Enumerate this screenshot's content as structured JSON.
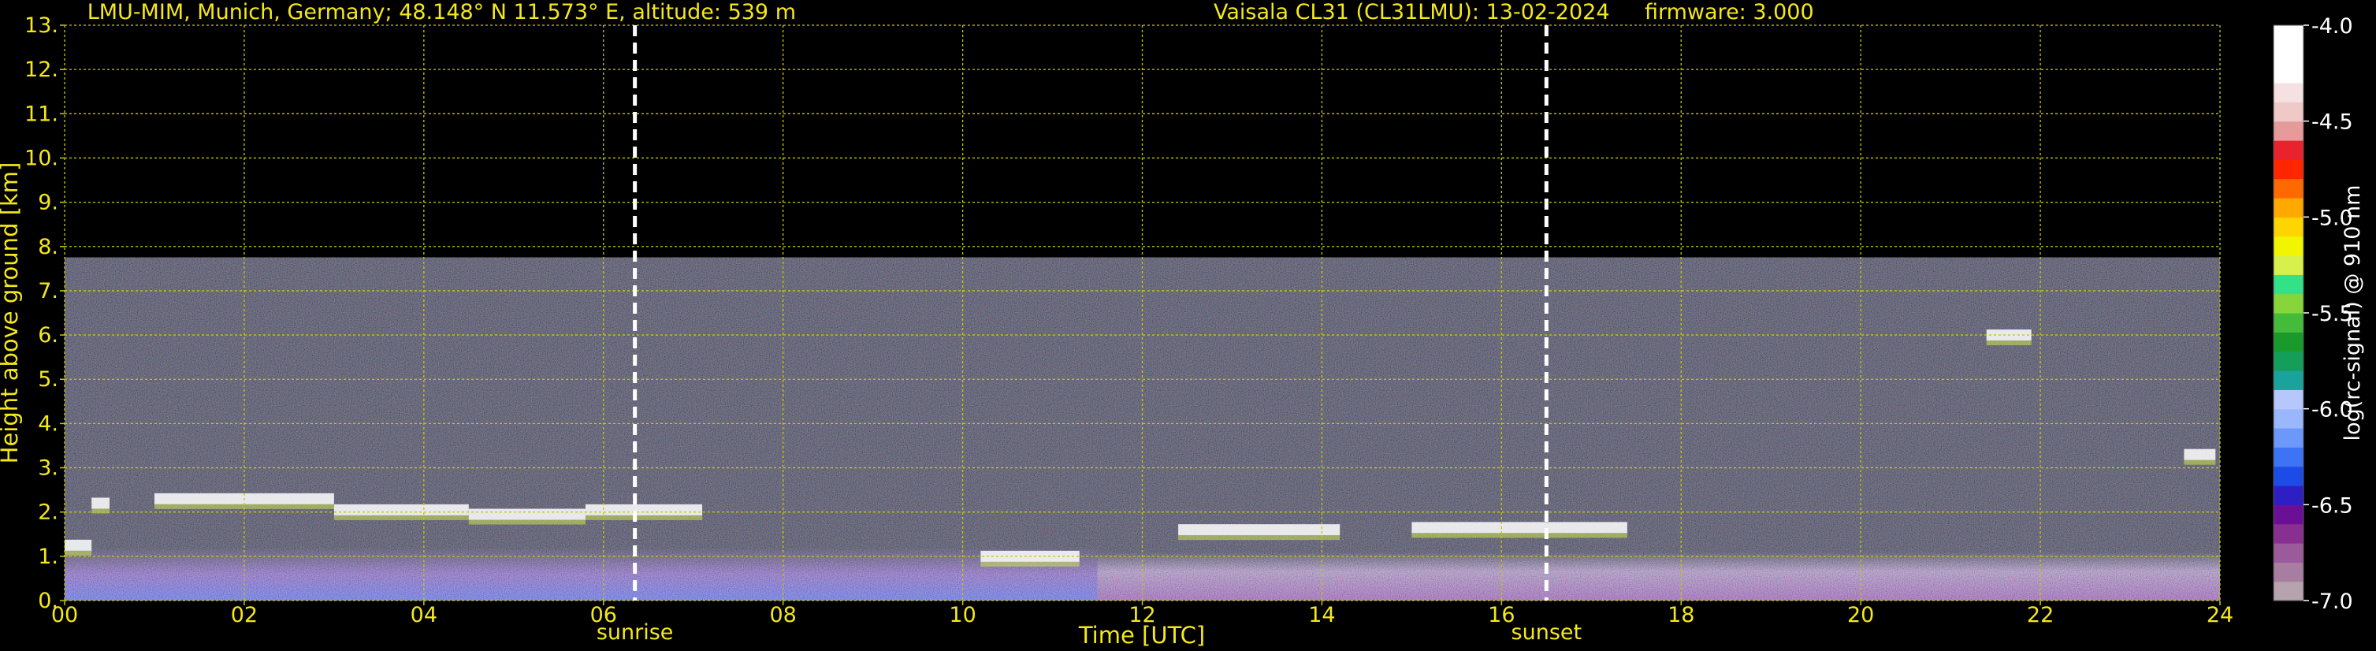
{
  "chart_data": {
    "type": "heatmap",
    "title_parts": [
      "LMU-MIM, Munich, Germany; 48.148° N 11.573° E, altitude: 539 m",
      "Vaisala CL31 (CL31LMU): 13-02-2024",
      "firmware: 3.000"
    ],
    "xlabel": "Time [UTC]",
    "ylabel": "Height above ground [km]",
    "xlim": [
      0,
      24
    ],
    "ylim": [
      0,
      13
    ],
    "x_ticks": [
      0,
      2,
      4,
      6,
      8,
      10,
      12,
      14,
      16,
      18,
      20,
      22,
      24
    ],
    "x_tick_labels": [
      "00",
      "02",
      "04",
      "06",
      "08",
      "10",
      "12",
      "14",
      "16",
      "18",
      "20",
      "22",
      "24"
    ],
    "y_ticks": [
      0,
      1,
      2,
      3,
      4,
      5,
      6,
      7,
      8,
      9,
      10,
      11,
      12,
      13
    ],
    "y_tick_labels": [
      "0.",
      "1.",
      "2.",
      "3.",
      "4.",
      "5.",
      "6.",
      "7.",
      "8.",
      "9.",
      "10.",
      "11.",
      "12.",
      "13."
    ],
    "grid": true,
    "grid_color": "#c8c800",
    "signal_top_km": 7.75,
    "events": [
      {
        "label": "sunrise",
        "time": 6.35
      },
      {
        "label": "sunset",
        "time": 16.5
      }
    ],
    "cloud_layers": [
      {
        "start": 0.0,
        "end": 0.3,
        "height": 1.25
      },
      {
        "start": 0.3,
        "end": 0.5,
        "height": 2.2
      },
      {
        "start": 1.0,
        "end": 3.0,
        "height": 2.3
      },
      {
        "start": 3.0,
        "end": 4.5,
        "height": 2.05
      },
      {
        "start": 4.5,
        "end": 5.8,
        "height": 1.95
      },
      {
        "start": 5.8,
        "end": 7.1,
        "height": 2.05
      },
      {
        "start": 10.2,
        "end": 11.3,
        "height": 1.0
      },
      {
        "start": 12.4,
        "end": 14.2,
        "height": 1.6
      },
      {
        "start": 15.0,
        "end": 17.4,
        "height": 1.65
      },
      {
        "start": 21.4,
        "end": 21.9,
        "height": 6.0
      },
      {
        "start": 23.6,
        "end": 23.95,
        "height": 3.3
      }
    ],
    "colorbar": {
      "label": "log(rc-signal) @ 910 nm",
      "range": [
        -7.0,
        -4.0
      ],
      "ticks": [
        -7.0,
        -6.5,
        -6.0,
        -5.5,
        -5.0,
        -4.5,
        -4.0
      ],
      "tick_labels": [
        "-7.0",
        "-6.5",
        "-6.0",
        "-5.5",
        "-5.0",
        "-4.5",
        "-4.0"
      ],
      "colors": [
        "#b7a3ae",
        "#a77ea2",
        "#9b5a9a",
        "#8a2f92",
        "#6b0f96",
        "#2e1fc4",
        "#1d4be6",
        "#3d73f5",
        "#6c97fb",
        "#9ab7fc",
        "#b6c8fb",
        "#1aa39c",
        "#149e59",
        "#1a9a2a",
        "#44bb3a",
        "#86d63a",
        "#33e284",
        "#d7f04c",
        "#f2f500",
        "#ffd500",
        "#ffa800",
        "#ff6a00",
        "#ff2600",
        "#e8232e",
        "#e79a9a",
        "#efc8c8",
        "#f5e1e1",
        "#ffffff",
        "#ffffff",
        "#ffffff"
      ]
    }
  }
}
